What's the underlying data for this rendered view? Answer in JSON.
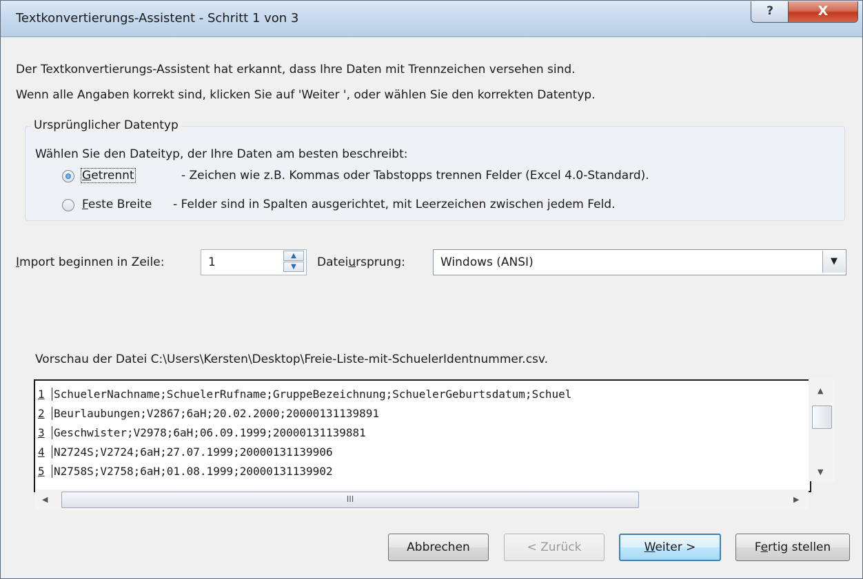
{
  "window": {
    "title": "Textkonvertierungs-Assistent - Schritt 1 von 3",
    "help_label": "?",
    "close_label": "X"
  },
  "intro": {
    "line1": "Der Textkonvertierungs-Assistent hat erkannt, dass Ihre Daten mit Trennzeichen versehen sind.",
    "line2": "Wenn alle Angaben korrekt sind, klicken Sie auf 'Weiter ', oder wählen Sie den korrekten Datentyp."
  },
  "datatype_group": {
    "legend": "Ursprünglicher Datentyp",
    "prompt": "Wählen Sie den Dateityp, der Ihre Daten am besten beschreibt:",
    "options": [
      {
        "mnemonic": "G",
        "rest": "etrennt",
        "description": "- Zeichen wie z.B. Kommas oder Tabstopps trennen Felder (Excel 4.0-Standard).",
        "checked": true
      },
      {
        "mnemonic": "F",
        "rest": "este Breite",
        "description": "- Felder sind in Spalten ausgerichtet, mit Leerzeichen zwischen jedem Feld.",
        "checked": false
      }
    ]
  },
  "import_row": {
    "start_mnemonic": "I",
    "start_rest": "mport beginnen in Zeile:",
    "start_value": "1",
    "origin_pre": "Datei",
    "origin_mnemonic": "u",
    "origin_post": "rsprung:",
    "origin_value": "Windows (ANSI)"
  },
  "preview": {
    "label": "Vorschau der Datei C:\\Users\\Kersten\\Desktop\\Freie-Liste-mit-SchuelerIdentnummer.csv.",
    "rows": [
      {
        "num": "1",
        "text": "SchuelerNachname;SchuelerRufname;GruppeBezeichnung;SchuelerGeburtsdatum;Schuel"
      },
      {
        "num": "2",
        "text": "Beurlaubungen;V2867;6aH;20.02.2000;20000131139891"
      },
      {
        "num": "3",
        "text": "Geschwister;V2978;6aH;06.09.1999;20000131139881"
      },
      {
        "num": "4",
        "text": "N2724S;V2724;6aH;27.07.1999;20000131139906"
      },
      {
        "num": "5",
        "text": "N2758S;V2758;6aH;01.08.1999;20000131139902"
      }
    ],
    "hthumb_grip": "III"
  },
  "buttons": {
    "cancel": "Abbrechen",
    "back": "< Zurück",
    "next_mnemonic": "W",
    "next_rest": "eiter >",
    "finish_pre": "F",
    "finish_mnemonic": "e",
    "finish_post": "rtig stellen"
  }
}
